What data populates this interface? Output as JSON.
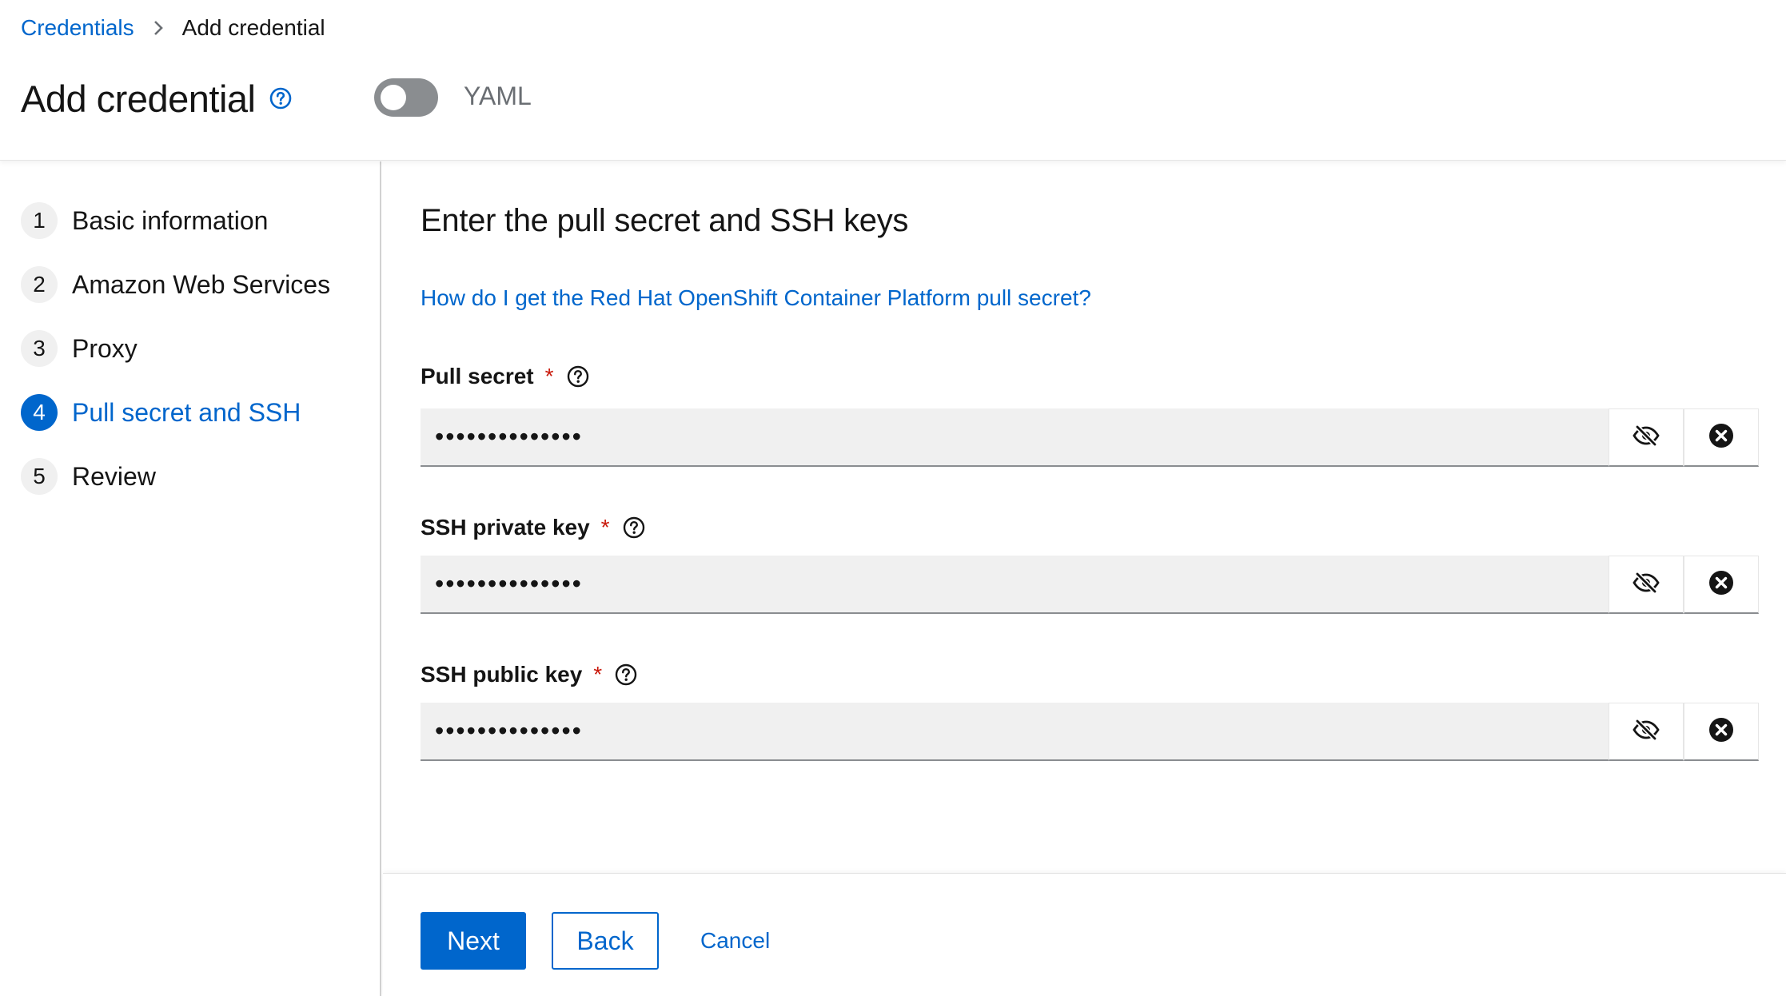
{
  "breadcrumb": {
    "parent": "Credentials",
    "current": "Add credential"
  },
  "header": {
    "title": "Add credential",
    "yaml_toggle_label": "YAML",
    "yaml_toggle_on": false
  },
  "wizard_nav": {
    "steps": [
      {
        "number": "1",
        "label": "Basic information",
        "active": false
      },
      {
        "number": "2",
        "label": "Amazon Web Services",
        "active": false
      },
      {
        "number": "3",
        "label": "Proxy",
        "active": false
      },
      {
        "number": "4",
        "label": "Pull secret and SSH",
        "active": true
      },
      {
        "number": "5",
        "label": "Review",
        "active": false
      }
    ]
  },
  "main": {
    "section_title": "Enter the pull secret and SSH keys",
    "help_link": "How do I get the Red Hat OpenShift Container Platform pull secret?",
    "fields": [
      {
        "label": "Pull secret",
        "required_mark": "*",
        "value": "••••••••••••••"
      },
      {
        "label": "SSH private key",
        "required_mark": "*",
        "value": "••••••••••••••"
      },
      {
        "label": "SSH public key",
        "required_mark": "*",
        "value": "••••••••••••••"
      }
    ]
  },
  "footer": {
    "next_label": "Next",
    "back_label": "Back",
    "cancel_label": "Cancel"
  },
  "colors": {
    "accent": "#0066cc",
    "required": "#c9190b",
    "input_bg": "#f0f0f0",
    "toggle_off": "#8a8d90"
  },
  "icons": {
    "breadcrumb_separator": "chevron-right-icon",
    "title_help": "help-circle-icon",
    "label_help": "help-circle-icon",
    "show_hide": "eye-slash-icon",
    "clear": "times-circle-icon"
  }
}
